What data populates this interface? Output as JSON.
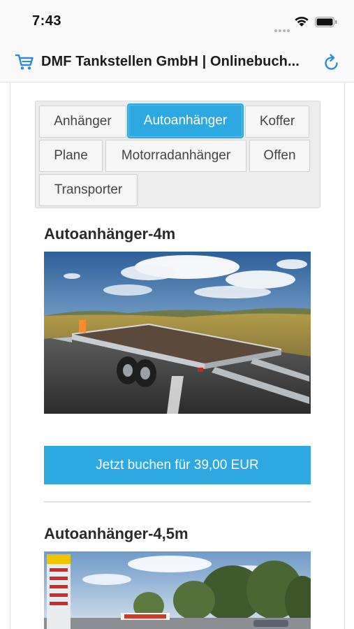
{
  "status_bar": {
    "time": "7:43"
  },
  "header": {
    "title": "DMF Tankstellen GmbH | Onlinebuch...",
    "icons": [
      "cart-icon",
      "refresh-icon"
    ],
    "accent_color": "#2e8bd8"
  },
  "tabs": [
    {
      "label": "Anhänger",
      "active": false
    },
    {
      "label": "Autoanhänger",
      "active": true
    },
    {
      "label": "Koffer",
      "active": false
    },
    {
      "label": "Plane",
      "active": false
    },
    {
      "label": "Motorradanhänger",
      "active": false
    },
    {
      "label": "Offen",
      "active": false
    },
    {
      "label": "Transporter",
      "active": false
    }
  ],
  "products": [
    {
      "title": "Autoanhänger-4m",
      "book_label": "Jetzt buchen für 39,00 EUR"
    },
    {
      "title": "Autoanhänger-4,5m"
    }
  ],
  "colors": {
    "primary": "#2ea8e0",
    "tab_bg": "#f6f6f6",
    "tab_box_bg": "#ececec"
  }
}
